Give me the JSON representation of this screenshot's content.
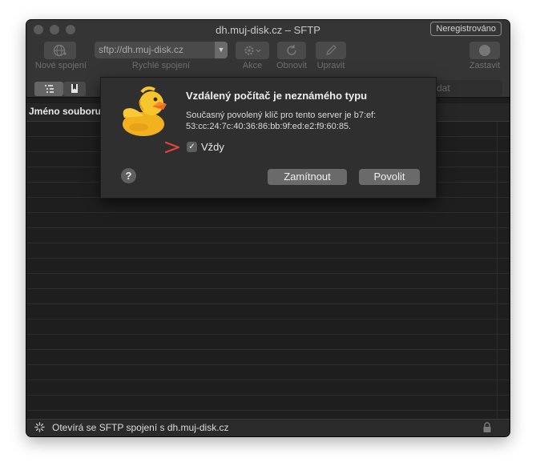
{
  "window": {
    "title": "dh.muj-disk.cz – SFTP",
    "badge": "Neregistrováno"
  },
  "toolbar": {
    "new_connection": "Nové spojení",
    "url_value": "sftp://dh.muj-disk.cz",
    "quick_connect": "Rychlé spojení",
    "actions": "Akce",
    "refresh": "Obnovit",
    "edit": "Upravit",
    "stop": "Zastavit"
  },
  "search": {
    "placeholder": "dat"
  },
  "browser": {
    "column_name": "Jméno souboru",
    "row_count": 19
  },
  "dialog": {
    "title": "Vzdálený počítač je neznámého typu",
    "message": "Současný povolený klíč pro tento server je b7:ef: 53:cc:24:7c:40:36:86:bb:9f:ed:e2:f9:60:85.",
    "checkbox_label": "Vždy",
    "checkbox_checked": true,
    "deny_button": "Zamítnout",
    "allow_button": "Povolit",
    "help": "?",
    "annotation_arrow": ">",
    "annotation_color": "#e0443e"
  },
  "status": {
    "text": "Otevírá se SFTP spojení s dh.muj-disk.cz"
  }
}
